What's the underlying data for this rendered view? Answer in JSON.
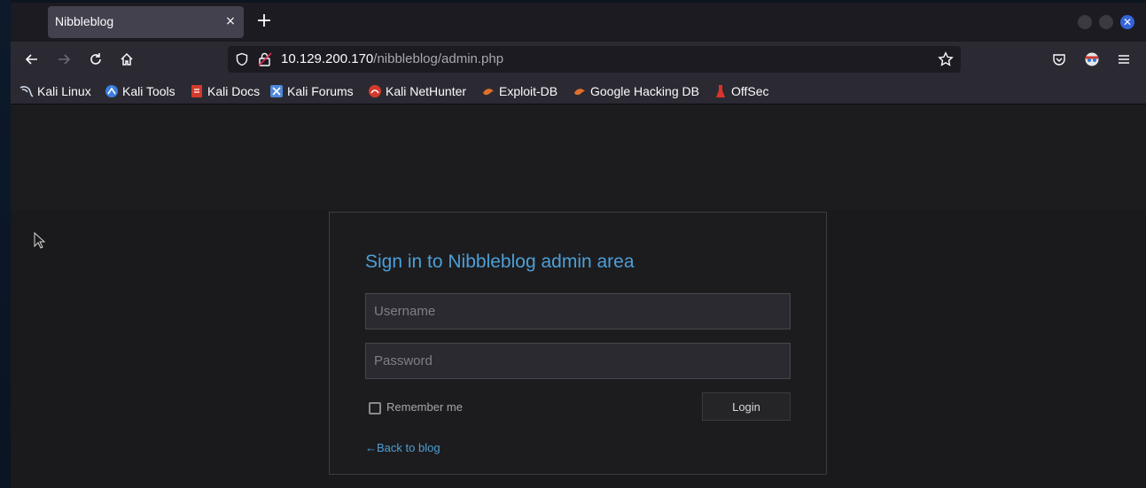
{
  "browser": {
    "tab_title": "Nibbleblog",
    "tab_close": "×",
    "new_tab": "+",
    "window_close": "✕",
    "url_host": "10.129.200.170",
    "url_path": "/nibbleblog/admin.php"
  },
  "bookmarks": [
    {
      "label": "Kali Linux",
      "icon": "kali-dragon-icon",
      "color": "#3a6fd8"
    },
    {
      "label": "Kali Tools",
      "icon": "kali-tools-icon",
      "color": "#3d7de0"
    },
    {
      "label": "Kali Docs",
      "icon": "kali-docs-icon",
      "color": "#d33a2c"
    },
    {
      "label": "Kali Forums",
      "icon": "kali-forums-icon",
      "color": "#4e87d9"
    },
    {
      "label": "Kali NetHunter",
      "icon": "nethunter-icon",
      "color": "#d33a2c"
    },
    {
      "label": "Exploit-DB",
      "icon": "exploit-db-icon",
      "color": "#e0702a"
    },
    {
      "label": "Google Hacking DB",
      "icon": "ghdb-icon",
      "color": "#e0702a"
    },
    {
      "label": "OffSec",
      "icon": "offsec-icon",
      "color": "#d9342b"
    }
  ],
  "login": {
    "title": "Sign in to Nibbleblog admin area",
    "username_placeholder": "Username",
    "password_placeholder": "Password",
    "remember_label": "Remember me",
    "login_button": "Login",
    "back_link": "←Back to blog"
  },
  "colors": {
    "accent": "#4d9fd7",
    "page_bg": "#1c1c1e",
    "toolbar_bg": "#2b2a33"
  }
}
